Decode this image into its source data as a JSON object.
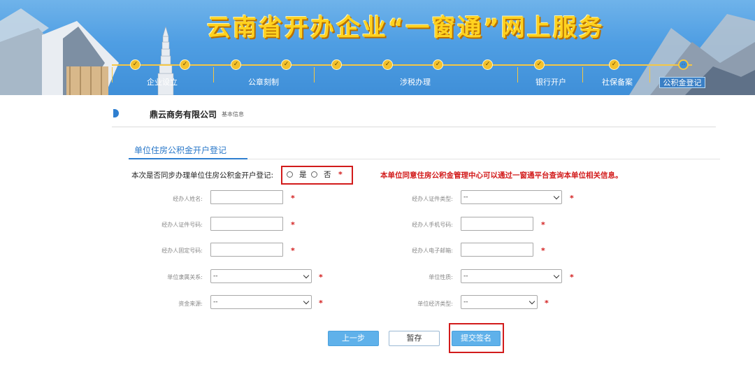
{
  "banner": {
    "title": "云南省开办企业“一窗通”网上服务",
    "steps": [
      {
        "label": "企业设立",
        "state": "done"
      },
      {
        "label": "公章刻制",
        "state": "done"
      },
      {
        "label": "涉税办理",
        "state": "done"
      },
      {
        "label": "银行开户",
        "state": "done"
      },
      {
        "label": "社保备案",
        "state": "done"
      },
      {
        "label": "公积金登记",
        "state": "current"
      }
    ]
  },
  "company": {
    "name": "鼎云商务有限公司",
    "sub": "基本信息"
  },
  "tab": {
    "label": "单位住房公积金开户登记"
  },
  "question": {
    "text": "本次是否同步办理单位住房公积金开户登记:",
    "yes_label": "是",
    "no_label": "否",
    "required_mark": "*",
    "notice": "本单位同意住房公积金管理中心可以通过一窗通平台查询本单位相关信息。"
  },
  "form": {
    "required_mark": "*",
    "left": [
      {
        "label": "经办人姓名:",
        "type": "input",
        "value": ""
      },
      {
        "label": "经办人证件号码:",
        "type": "input",
        "value": ""
      },
      {
        "label": "经办人固定号码:",
        "type": "input",
        "value": ""
      },
      {
        "label": "单位隶属关系:",
        "type": "select",
        "value": "--"
      },
      {
        "label": "资金来源:",
        "type": "select",
        "value": "--"
      }
    ],
    "right": [
      {
        "label": "经办人证件类型:",
        "type": "select",
        "value": "--"
      },
      {
        "label": "经办人手机号码:",
        "type": "input",
        "value": ""
      },
      {
        "label": "经办人电子邮箱:",
        "type": "input",
        "value": ""
      },
      {
        "label": "单位性质:",
        "type": "select",
        "value": "--"
      },
      {
        "label": "单位经济类型:",
        "type": "select",
        "value": "--"
      }
    ]
  },
  "buttons": {
    "prev": "上一步",
    "save": "暂存",
    "submit": "提交签名"
  },
  "colors": {
    "accent_blue": "#2f7fd0",
    "banner_blue": "#4f9ee3",
    "highlight_red": "#d21b1b",
    "title_yellow": "#ffd21f"
  }
}
